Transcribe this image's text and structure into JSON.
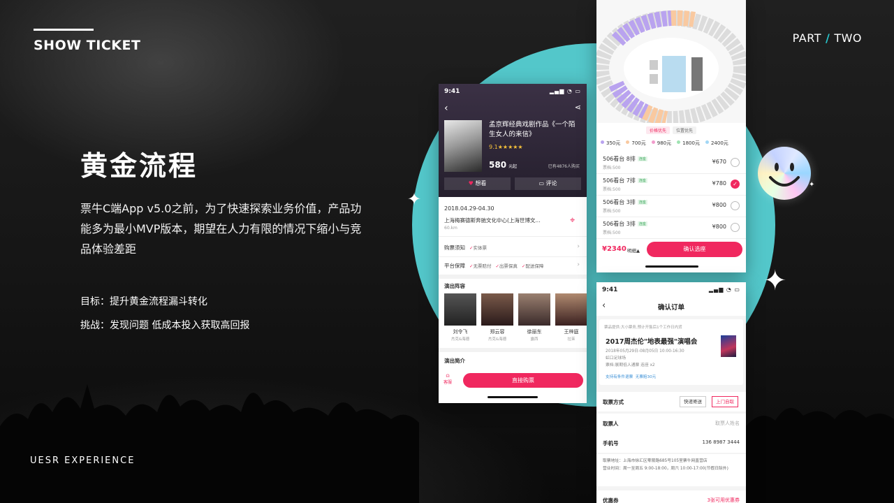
{
  "brand": "SHOW TICKET",
  "part": {
    "left": "PART",
    "slash": "/",
    "right": "TWO"
  },
  "footer": "UESR EXPERIENCE",
  "heading": "黄金流程",
  "description": "票牛C端App v5.0之前，为了快速探索业务价值，产品功能多为最小MVP版本，期望在人力有限的情况下缩小与竞品体验差距",
  "goal": "目标：提升黄金流程漏斗转化",
  "challenge": "挑战：发现问题 低成本投入获取高回报",
  "colors": {
    "accent": "#28c6cc",
    "circle": "#53c7ca",
    "pink": "#f0285f"
  },
  "detail_screen": {
    "time": "9:41",
    "title": "孟京辉经典戏剧作品《一个陌生女人的来信》",
    "rating": "9.1★★★★★",
    "price": "580",
    "price_unit": "元起",
    "bought": "已有4876人购买",
    "want": "想看",
    "comment": "评论",
    "date": "2018.04.29-04.30",
    "venue": "上海梅赛德斯奔驰文化中心(上海世博文...",
    "distance": "60.km",
    "notice_label": "购票须知",
    "notice_tags": [
      "实体票"
    ],
    "guarantee_label": "平台保障",
    "guarantee_tags": [
      "无票赔付",
      "出票保真",
      "配送保障"
    ],
    "cast_label": "演出阵容",
    "cast": [
      {
        "name": "刘令飞",
        "role": "杰克&海德"
      },
      {
        "name": "郑云容",
        "role": "杰克&海德"
      },
      {
        "name": "徐丽东",
        "role": "露西"
      },
      {
        "name": "王梓庭",
        "role": "拉茉"
      }
    ],
    "intro_label": "演出简介",
    "service": "客服",
    "buy_button": "直接购票"
  },
  "seat_screen": {
    "toggles": [
      "价格优先",
      "位置优先"
    ],
    "price_levels": [
      {
        "label": "350元",
        "color": "#b9a3ef"
      },
      {
        "label": "700元",
        "color": "#f9c9a0"
      },
      {
        "label": "980元",
        "color": "#f29ccc"
      },
      {
        "label": "1800元",
        "color": "#9fe3b2"
      },
      {
        "label": "2400元",
        "color": "#a2d7f5"
      }
    ],
    "seats": [
      {
        "name": "506看台 8排",
        "tag": "连座",
        "sub": "票档:500",
        "price": "¥670",
        "selected": false
      },
      {
        "name": "506看台 7排",
        "tag": "连座",
        "sub": "票档:500",
        "price": "¥780",
        "selected": true
      },
      {
        "name": "506看台 3排",
        "tag": "连座",
        "sub": "票档:500",
        "price": "¥800",
        "selected": false
      },
      {
        "name": "506看台 3排",
        "tag": "连座",
        "sub": "票档:500",
        "price": "¥800",
        "selected": false
      }
    ],
    "total": "¥2340",
    "detail": "明细▲",
    "confirm_button": "确认选座"
  },
  "order_screen": {
    "time": "9:41",
    "title": "确认订单",
    "tip": "票品提供:大小票务,预计开售后1个工作日内货",
    "event": "2017周杰伦\"地表最强\"演唱会",
    "datetime": "2018年05月29日-08月05日 10:00-16:30",
    "place": "虹口足球场",
    "ticket": "票档:展期低人通票  连座 x2",
    "badges": [
      "支持有条件退票",
      "无票赔30元"
    ],
    "delivery_label": "取票方式",
    "delivery_options": [
      "快递寄送",
      "上门自取"
    ],
    "pickup_label": "取票人",
    "pickup_placeholder": "取票人姓名",
    "phone_label": "手机号",
    "phone_value": "136 8987 3444",
    "address": "取票地址：上海市徐汇区零陵路685号105室票牛网直营店",
    "hours": "营业时间：周一至周五 9:00-18:00，周六 10:00-17:00(节假日除外)",
    "coupon_label": "优惠券",
    "coupon_value": "3张可用优惠券"
  }
}
